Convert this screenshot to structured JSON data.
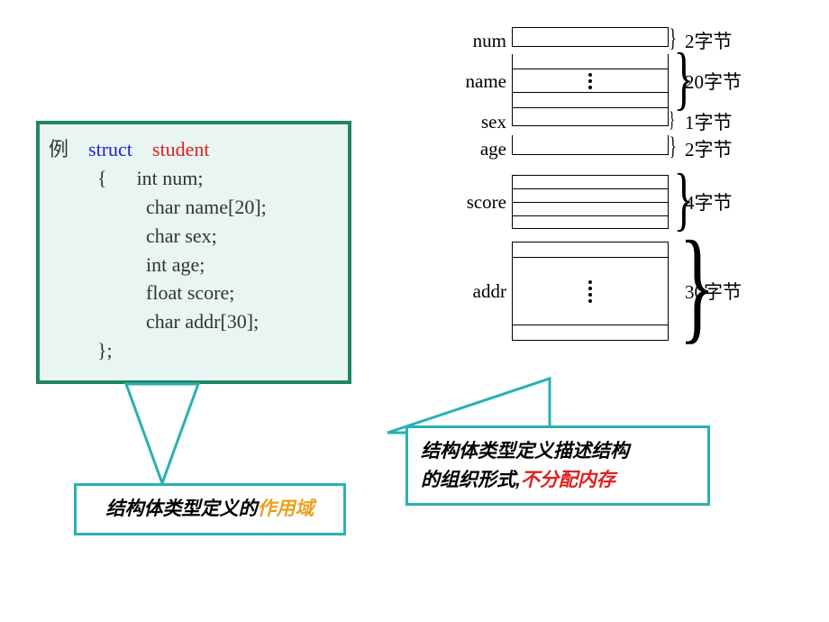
{
  "code": {
    "example_label": "例",
    "struct_kw": "struct",
    "struct_name": "student",
    "brace_open": "{",
    "l1": "int num;",
    "l2": "char  name[20];",
    "l3": "char sex;",
    "l4": "int age;",
    "l5": "float score;",
    "l6": "char addr[30];",
    "brace_close": "};"
  },
  "diagram": {
    "num": {
      "label": "num",
      "bytes": "2字节"
    },
    "name": {
      "label": "name",
      "bytes": "20字节"
    },
    "sex": {
      "label": "sex",
      "bytes": "1字节"
    },
    "age": {
      "label": "age",
      "bytes": "2字节"
    },
    "score": {
      "label": "score",
      "bytes": "4字节"
    },
    "addr": {
      "label": "addr",
      "bytes": "30字节"
    }
  },
  "callout1": {
    "t1": "结构体类型定义的",
    "t2": "作用域"
  },
  "callout2": {
    "t1": "结构体类型定义描述结构",
    "t2": "的组织形式,",
    "t3": "不分配内存"
  }
}
